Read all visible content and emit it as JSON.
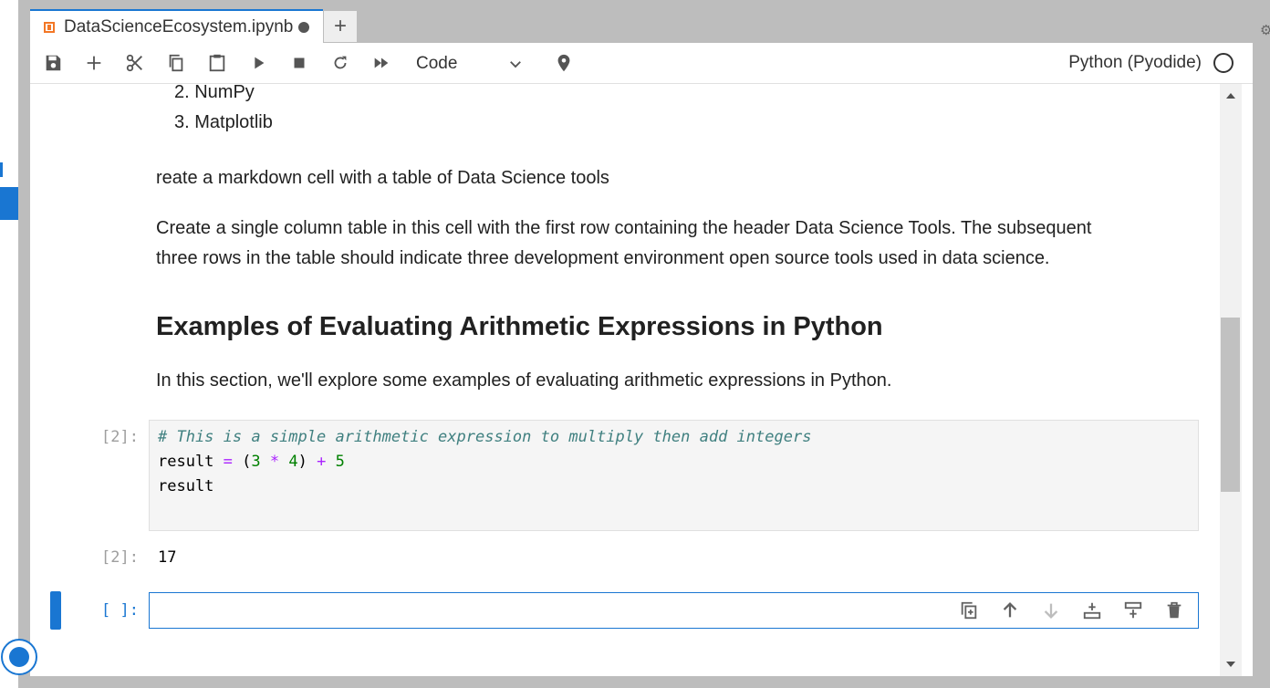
{
  "tab": {
    "title": "DataScienceEcosystem.ipynb",
    "new_tab_label": "+"
  },
  "toolbar": {
    "buttons": [
      "save-icon",
      "add-cell-icon",
      "cut-icon",
      "copy-icon",
      "paste-icon",
      "run-icon",
      "stop-icon",
      "restart-icon",
      "run-all-icon"
    ],
    "cell_type": "Code",
    "kernel_name": "Python (Pyodide)"
  },
  "notebook": {
    "list_items": [
      "2. NumPy",
      "3. Matplotlib"
    ],
    "para1": "reate a markdown cell with a table of Data Science tools",
    "para2_line1": "Create a single column table in this cell with the first row containing the header Data Science Tools. The subsequent",
    "para2_line2": "three rows in the table should indicate three development environment open source tools used in data science.",
    "heading": "Examples of Evaluating Arithmetic Expressions in Python",
    "para3": "In this section, we'll explore some examples of evaluating arithmetic expressions in Python.",
    "code_cell": {
      "prompt": "[2]:",
      "comment": "# This is a simple arithmetic expression to multiply then add integers",
      "line2": {
        "a": "result ",
        "eq": "=",
        "b": " (",
        "n1": "3",
        "sp1": " ",
        "mul": "*",
        "sp2": " ",
        "n2": "4",
        "c": ") ",
        "plus": "+",
        "sp3": " ",
        "n3": "5"
      },
      "line3": "result"
    },
    "output": {
      "prompt": "[2]:",
      "value": "17"
    },
    "empty_cell": {
      "prompt": "[ ]:"
    }
  },
  "colors": {
    "accent": "#1976d2",
    "notebook_icon": "#f37726"
  }
}
